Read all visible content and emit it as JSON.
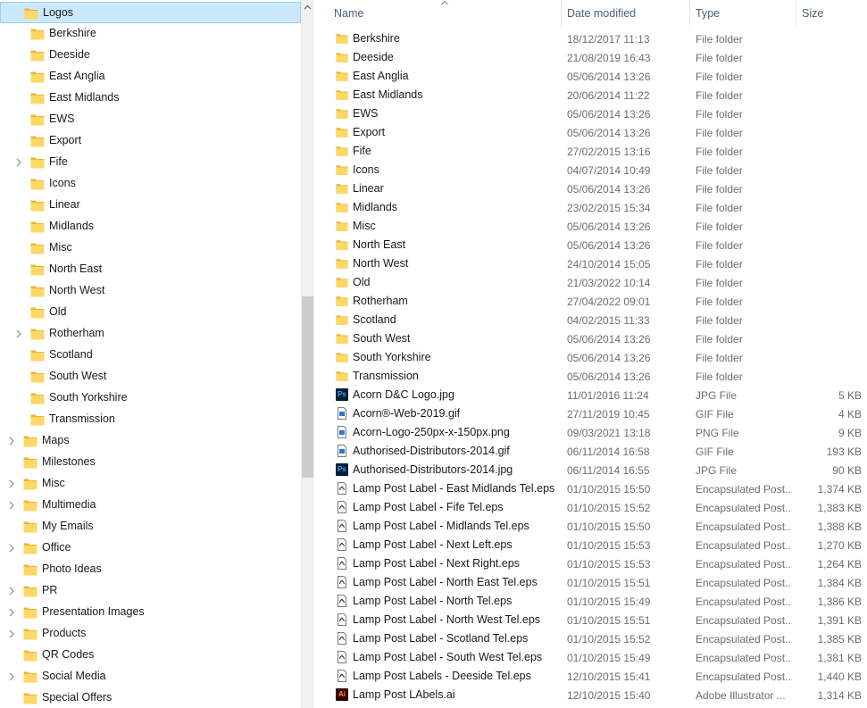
{
  "nav_tree": {
    "items": [
      {
        "label": "Logos",
        "level": 0,
        "expandable": false,
        "selected": true
      },
      {
        "label": "Berkshire",
        "level": 1,
        "expandable": false
      },
      {
        "label": "Deeside",
        "level": 1,
        "expandable": false
      },
      {
        "label": "East Anglia",
        "level": 1,
        "expandable": false
      },
      {
        "label": "East Midlands",
        "level": 1,
        "expandable": false
      },
      {
        "label": "EWS",
        "level": 1,
        "expandable": false
      },
      {
        "label": "Export",
        "level": 1,
        "expandable": false
      },
      {
        "label": "Fife",
        "level": 1,
        "expandable": true
      },
      {
        "label": "Icons",
        "level": 1,
        "expandable": false
      },
      {
        "label": "Linear",
        "level": 1,
        "expandable": false
      },
      {
        "label": "Midlands",
        "level": 1,
        "expandable": false
      },
      {
        "label": "Misc",
        "level": 1,
        "expandable": false
      },
      {
        "label": "North East",
        "level": 1,
        "expandable": false
      },
      {
        "label": "North West",
        "level": 1,
        "expandable": false
      },
      {
        "label": "Old",
        "level": 1,
        "expandable": false
      },
      {
        "label": "Rotherham",
        "level": 1,
        "expandable": true
      },
      {
        "label": "Scotland",
        "level": 1,
        "expandable": false
      },
      {
        "label": "South West",
        "level": 1,
        "expandable": false
      },
      {
        "label": "South Yorkshire",
        "level": 1,
        "expandable": false
      },
      {
        "label": "Transmission",
        "level": 1,
        "expandable": false
      },
      {
        "label": "Maps",
        "level": 0,
        "expandable": true
      },
      {
        "label": "Milestones",
        "level": 0,
        "expandable": false
      },
      {
        "label": "Misc",
        "level": 0,
        "expandable": true
      },
      {
        "label": "Multimedia",
        "level": 0,
        "expandable": true
      },
      {
        "label": "My Emails",
        "level": 0,
        "expandable": false
      },
      {
        "label": "Office",
        "level": 0,
        "expandable": true
      },
      {
        "label": "Photo Ideas",
        "level": 0,
        "expandable": false
      },
      {
        "label": "PR",
        "level": 0,
        "expandable": true
      },
      {
        "label": "Presentation Images",
        "level": 0,
        "expandable": true
      },
      {
        "label": "Products",
        "level": 0,
        "expandable": true
      },
      {
        "label": "QR Codes",
        "level": 0,
        "expandable": false
      },
      {
        "label": "Social Media",
        "level": 0,
        "expandable": true
      },
      {
        "label": "Special Offers",
        "level": 0,
        "expandable": false
      }
    ]
  },
  "columns": {
    "name": "Name",
    "date": "Date modified",
    "type": "Type",
    "size": "Size"
  },
  "files": [
    {
      "name": "Berkshire",
      "date": "18/12/2017 11:13",
      "type": "File folder",
      "size": "",
      "icon": "folder-icon"
    },
    {
      "name": "Deeside",
      "date": "21/08/2019 16:43",
      "type": "File folder",
      "size": "",
      "icon": "folder-icon"
    },
    {
      "name": "East Anglia",
      "date": "05/06/2014 13:26",
      "type": "File folder",
      "size": "",
      "icon": "folder-icon"
    },
    {
      "name": "East Midlands",
      "date": "20/06/2014 11:22",
      "type": "File folder",
      "size": "",
      "icon": "folder-icon"
    },
    {
      "name": "EWS",
      "date": "05/06/2014 13:26",
      "type": "File folder",
      "size": "",
      "icon": "folder-icon"
    },
    {
      "name": "Export",
      "date": "05/06/2014 13:26",
      "type": "File folder",
      "size": "",
      "icon": "folder-icon"
    },
    {
      "name": "Fife",
      "date": "27/02/2015 13:16",
      "type": "File folder",
      "size": "",
      "icon": "folder-icon"
    },
    {
      "name": "Icons",
      "date": "04/07/2014 10:49",
      "type": "File folder",
      "size": "",
      "icon": "folder-icon"
    },
    {
      "name": "Linear",
      "date": "05/06/2014 13:26",
      "type": "File folder",
      "size": "",
      "icon": "folder-icon"
    },
    {
      "name": "Midlands",
      "date": "23/02/2015 15:34",
      "type": "File folder",
      "size": "",
      "icon": "folder-icon"
    },
    {
      "name": "Misc",
      "date": "05/06/2014 13:26",
      "type": "File folder",
      "size": "",
      "icon": "folder-icon"
    },
    {
      "name": "North East",
      "date": "05/06/2014 13:26",
      "type": "File folder",
      "size": "",
      "icon": "folder-icon"
    },
    {
      "name": "North West",
      "date": "24/10/2014 15:05",
      "type": "File folder",
      "size": "",
      "icon": "folder-icon"
    },
    {
      "name": "Old",
      "date": "21/03/2022 10:14",
      "type": "File folder",
      "size": "",
      "icon": "folder-icon"
    },
    {
      "name": "Rotherham",
      "date": "27/04/2022 09:01",
      "type": "File folder",
      "size": "",
      "icon": "folder-icon"
    },
    {
      "name": "Scotland",
      "date": "04/02/2015 11:33",
      "type": "File folder",
      "size": "",
      "icon": "folder-icon"
    },
    {
      "name": "South West",
      "date": "05/06/2014 13:26",
      "type": "File folder",
      "size": "",
      "icon": "folder-icon"
    },
    {
      "name": "South Yorkshire",
      "date": "05/06/2014 13:26",
      "type": "File folder",
      "size": "",
      "icon": "folder-icon"
    },
    {
      "name": "Transmission",
      "date": "05/06/2014 13:26",
      "type": "File folder",
      "size": "",
      "icon": "folder-icon"
    },
    {
      "name": "Acorn D&C Logo.jpg",
      "date": "11/01/2016 11:24",
      "type": "JPG File",
      "size": "5 KB",
      "icon": "photoshop-icon"
    },
    {
      "name": "Acorn®-Web-2019.gif",
      "date": "27/11/2019 10:45",
      "type": "GIF File",
      "size": "4 KB",
      "icon": "image-file-icon"
    },
    {
      "name": "Acorn-Logo-250px-x-150px.png",
      "date": "09/03/2021 13:18",
      "type": "PNG File",
      "size": "9 KB",
      "icon": "image-file-icon"
    },
    {
      "name": "Authorised-Distributors-2014.gif",
      "date": "06/11/2014 16:58",
      "type": "GIF File",
      "size": "193 KB",
      "icon": "image-file-icon"
    },
    {
      "name": "Authorised-Distributors-2014.jpg",
      "date": "06/11/2014 16:55",
      "type": "JPG File",
      "size": "90 KB",
      "icon": "photoshop-icon"
    },
    {
      "name": "Lamp Post Label - East Midlands Tel.eps",
      "date": "01/10/2015 15:50",
      "type": "Encapsulated Post...",
      "size": "1,374 KB",
      "icon": "eps-file-icon"
    },
    {
      "name": "Lamp Post Label - Fife Tel.eps",
      "date": "01/10/2015 15:52",
      "type": "Encapsulated Post...",
      "size": "1,383 KB",
      "icon": "eps-file-icon"
    },
    {
      "name": "Lamp Post Label - Midlands Tel.eps",
      "date": "01/10/2015 15:50",
      "type": "Encapsulated Post...",
      "size": "1,388 KB",
      "icon": "eps-file-icon"
    },
    {
      "name": "Lamp Post Label - Next Left.eps",
      "date": "01/10/2015 15:53",
      "type": "Encapsulated Post...",
      "size": "1,270 KB",
      "icon": "eps-file-icon"
    },
    {
      "name": "Lamp Post Label - Next Right.eps",
      "date": "01/10/2015 15:53",
      "type": "Encapsulated Post...",
      "size": "1,264 KB",
      "icon": "eps-file-icon"
    },
    {
      "name": "Lamp Post Label - North East Tel.eps",
      "date": "01/10/2015 15:51",
      "type": "Encapsulated Post...",
      "size": "1,384 KB",
      "icon": "eps-file-icon"
    },
    {
      "name": "Lamp Post Label - North Tel.eps",
      "date": "01/10/2015 15:49",
      "type": "Encapsulated Post...",
      "size": "1,386 KB",
      "icon": "eps-file-icon"
    },
    {
      "name": "Lamp Post Label - North West Tel.eps",
      "date": "01/10/2015 15:51",
      "type": "Encapsulated Post...",
      "size": "1,391 KB",
      "icon": "eps-file-icon"
    },
    {
      "name": "Lamp Post Label - Scotland Tel.eps",
      "date": "01/10/2015 15:52",
      "type": "Encapsulated Post...",
      "size": "1,385 KB",
      "icon": "eps-file-icon"
    },
    {
      "name": "Lamp Post Label - South West Tel.eps",
      "date": "01/10/2015 15:49",
      "type": "Encapsulated Post...",
      "size": "1,381 KB",
      "icon": "eps-file-icon"
    },
    {
      "name": "Lamp Post Labels - Deeside Tel.eps",
      "date": "12/10/2015 15:41",
      "type": "Encapsulated Post...",
      "size": "1,440 KB",
      "icon": "eps-file-icon"
    },
    {
      "name": "Lamp Post LAbels.ai",
      "date": "12/10/2015 15:40",
      "type": "Adobe Illustrator ...",
      "size": "1,314 KB",
      "icon": "illustrator-icon"
    }
  ],
  "icon_labels": {
    "photoshop": "Ps",
    "illustrator": "Ai"
  },
  "colors": {
    "folder": "#ffd766",
    "folder_dark": "#e8b734",
    "selection_bg": "#cce8ff",
    "selection_border": "#99d1ff"
  }
}
